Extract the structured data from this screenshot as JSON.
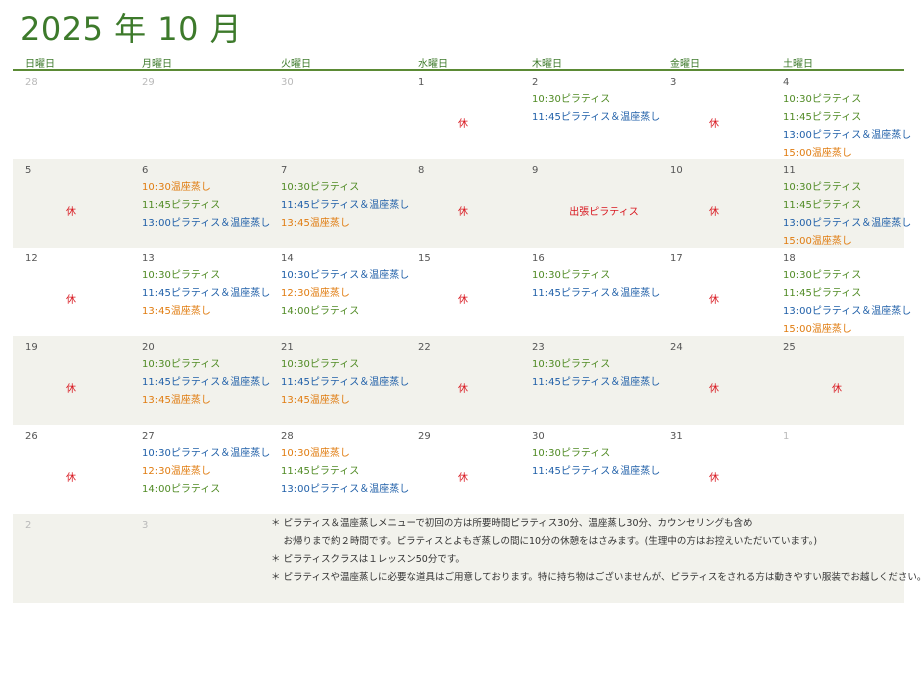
{
  "title": "2025 年 10 月",
  "weekdays": [
    "日曜日",
    "月曜日",
    "火曜日",
    "水曜日",
    "木曜日",
    "金曜日",
    "土曜日"
  ],
  "weeks": [
    [
      {
        "day": "28",
        "muted": true,
        "events": []
      },
      {
        "day": "29",
        "muted": true,
        "events": []
      },
      {
        "day": "30",
        "muted": true,
        "events": []
      },
      {
        "day": "1",
        "closed": "休",
        "events": []
      },
      {
        "day": "2",
        "events": [
          {
            "t": "10:30ピラティス",
            "c": "green"
          },
          {
            "t": "11:45ピラティス＆温座蒸し",
            "c": "blue"
          }
        ]
      },
      {
        "day": "3",
        "closed": "休",
        "events": []
      },
      {
        "day": "4",
        "events": [
          {
            "t": "10:30ピラティス",
            "c": "green"
          },
          {
            "t": "11:45ピラティス",
            "c": "green"
          },
          {
            "t": "13:00ピラティス＆温座蒸し",
            "c": "blue"
          },
          {
            "t": "15:00温座蒸し",
            "c": "orange"
          }
        ]
      }
    ],
    [
      {
        "day": "5",
        "closed": "休",
        "events": []
      },
      {
        "day": "6",
        "events": [
          {
            "t": "10:30温座蒸し",
            "c": "orange"
          },
          {
            "t": "11:45ピラティス",
            "c": "green"
          },
          {
            "t": "13:00ピラティス＆温座蒸し",
            "c": "blue"
          }
        ]
      },
      {
        "day": "7",
        "events": [
          {
            "t": "10:30ピラティス",
            "c": "green"
          },
          {
            "t": "11:45ピラティス＆温座蒸し",
            "c": "blue"
          },
          {
            "t": "13:45温座蒸し",
            "c": "orange"
          }
        ]
      },
      {
        "day": "8",
        "closed": "休",
        "events": []
      },
      {
        "day": "9",
        "closed": "出張ピラティス",
        "events": []
      },
      {
        "day": "10",
        "closed": "休",
        "events": []
      },
      {
        "day": "11",
        "events": [
          {
            "t": "10:30ピラティス",
            "c": "green"
          },
          {
            "t": "11:45ピラティス",
            "c": "green"
          },
          {
            "t": "13:00ピラティス＆温座蒸し",
            "c": "blue"
          },
          {
            "t": "15:00温座蒸し",
            "c": "orange"
          }
        ]
      }
    ],
    [
      {
        "day": "12",
        "closed": "休",
        "events": []
      },
      {
        "day": "13",
        "events": [
          {
            "t": "10:30ピラティス",
            "c": "green"
          },
          {
            "t": "11:45ピラティス＆温座蒸し",
            "c": "blue"
          },
          {
            "t": "13:45温座蒸し",
            "c": "orange"
          }
        ]
      },
      {
        "day": "14",
        "events": [
          {
            "t": "10:30ピラティス＆温座蒸し",
            "c": "blue"
          },
          {
            "t": "12:30温座蒸し",
            "c": "orange"
          },
          {
            "t": "14:00ピラティス",
            "c": "green"
          }
        ]
      },
      {
        "day": "15",
        "closed": "休",
        "events": []
      },
      {
        "day": "16",
        "events": [
          {
            "t": "10:30ピラティス",
            "c": "green"
          },
          {
            "t": "11:45ピラティス＆温座蒸し",
            "c": "blue"
          }
        ]
      },
      {
        "day": "17",
        "closed": "休",
        "events": []
      },
      {
        "day": "18",
        "events": [
          {
            "t": "10:30ピラティス",
            "c": "green"
          },
          {
            "t": "11:45ピラティス",
            "c": "green"
          },
          {
            "t": "13:00ピラティス＆温座蒸し",
            "c": "blue"
          },
          {
            "t": "15:00温座蒸し",
            "c": "orange"
          }
        ]
      }
    ],
    [
      {
        "day": "19",
        "closed": "休",
        "events": []
      },
      {
        "day": "20",
        "events": [
          {
            "t": "10:30ピラティス",
            "c": "green"
          },
          {
            "t": "11:45ピラティス＆温座蒸し",
            "c": "blue"
          },
          {
            "t": "13:45温座蒸し",
            "c": "orange"
          }
        ]
      },
      {
        "day": "21",
        "events": [
          {
            "t": "10:30ピラティス",
            "c": "green"
          },
          {
            "t": "11:45ピラティス＆温座蒸し",
            "c": "blue"
          },
          {
            "t": "13:45温座蒸し",
            "c": "orange"
          }
        ]
      },
      {
        "day": "22",
        "closed": "休",
        "events": []
      },
      {
        "day": "23",
        "events": [
          {
            "t": "10:30ピラティス",
            "c": "green"
          },
          {
            "t": "11:45ピラティス＆温座蒸し",
            "c": "blue"
          }
        ]
      },
      {
        "day": "24",
        "closed": "休",
        "events": []
      },
      {
        "day": "25",
        "closed": "休",
        "events": []
      }
    ],
    [
      {
        "day": "26",
        "closed": "休",
        "events": []
      },
      {
        "day": "27",
        "events": [
          {
            "t": "10:30ピラティス＆温座蒸し",
            "c": "blue"
          },
          {
            "t": "12:30温座蒸し",
            "c": "orange"
          },
          {
            "t": "14:00ピラティス",
            "c": "green"
          }
        ]
      },
      {
        "day": "28",
        "events": [
          {
            "t": "10:30温座蒸し",
            "c": "orange"
          },
          {
            "t": "11:45ピラティス",
            "c": "green"
          },
          {
            "t": "13:00ピラティス＆温座蒸し",
            "c": "blue"
          }
        ]
      },
      {
        "day": "29",
        "closed": "休",
        "events": []
      },
      {
        "day": "30",
        "events": [
          {
            "t": "10:30ピラティス",
            "c": "green"
          },
          {
            "t": "11:45ピラティス＆温座蒸し",
            "c": "blue"
          }
        ]
      },
      {
        "day": "31",
        "closed": "休",
        "events": []
      },
      {
        "day": "1",
        "muted": true,
        "events": []
      }
    ],
    [
      {
        "day": "2",
        "muted": true,
        "events": []
      },
      {
        "day": "3",
        "muted": true,
        "events": []
      }
    ]
  ],
  "notes": [
    "＊ ピラティス＆温座蒸しメニューで初回の方は所要時間ピラティス30分、温座蒸し30分、カウンセリングも含め",
    "　 お帰りまで約２時間です。ピラティスとよもぎ蒸しの間に10分の休憩をはさみます。(生理中の方はお控えいただいています。)",
    "＊ ピラティスクラスは１レッスン50分です。",
    "＊ ピラティスや温座蒸しに必要な道具はご用意しております。特に持ち物はございませんが、ピラティスをされる方は動きやすい服装でお越しください。"
  ],
  "colors": {
    "green": "#4f8a23",
    "blue": "#1f5fa8",
    "orange": "#e07c10",
    "red": "#d8161e",
    "title": "#3d7a2b"
  }
}
